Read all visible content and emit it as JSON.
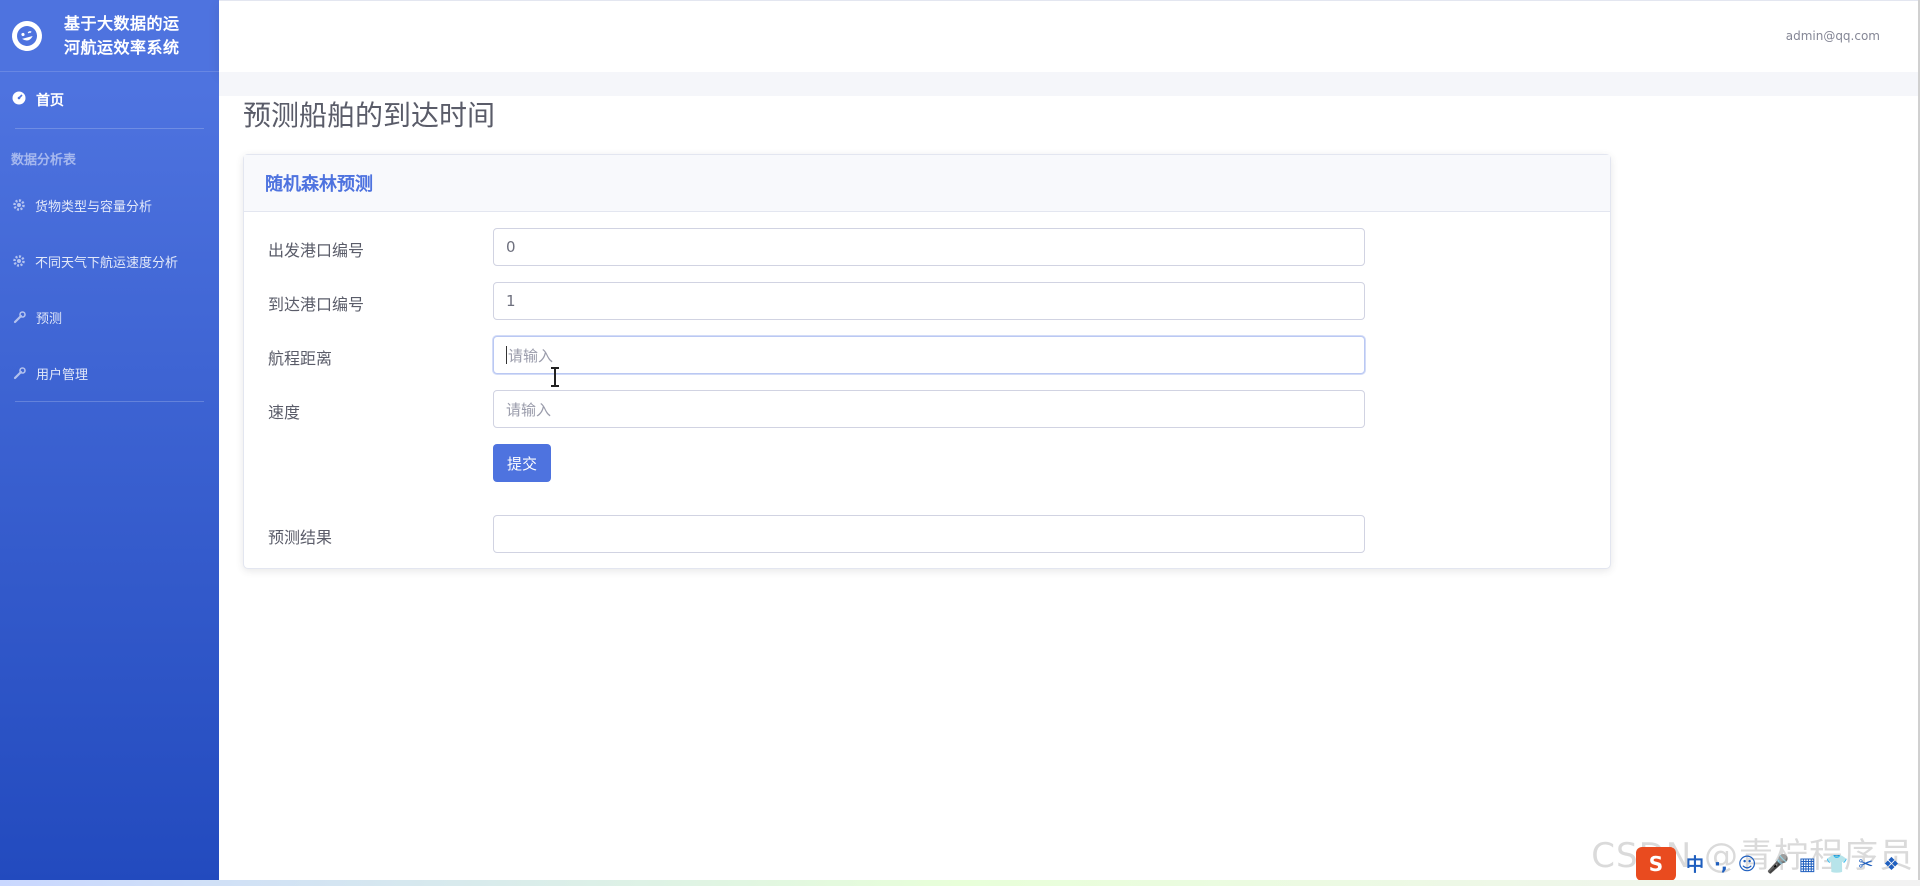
{
  "brand": {
    "title": "基于大数据的运河航运效率系统"
  },
  "sidebar": {
    "home_label": "首页",
    "section_heading": "数据分析表",
    "items": [
      {
        "label": "货物类型与容量分析",
        "icon": "gear-icon"
      },
      {
        "label": "不同天气下航运速度分析",
        "icon": "gear-icon"
      },
      {
        "label": "预测",
        "icon": "wrench-icon"
      },
      {
        "label": "用户管理",
        "icon": "wrench-icon"
      }
    ]
  },
  "topbar": {
    "user_email": "admin@qq.com"
  },
  "page": {
    "title": "预测船舶的到达时间"
  },
  "card": {
    "header": "随机森林预测",
    "fields": [
      {
        "label": "出发港口编号",
        "value": "0",
        "placeholder": ""
      },
      {
        "label": "到达港口编号",
        "value": "1",
        "placeholder": ""
      },
      {
        "label": "航程距离",
        "value": "",
        "placeholder": "请输入"
      },
      {
        "label": "速度",
        "value": "",
        "placeholder": "请输入"
      }
    ],
    "submit_label": "提交",
    "result": {
      "label": "预测结果",
      "value": ""
    }
  },
  "overlay": {
    "watermark": "CSDN @青柠程序员",
    "tray_logo": "S",
    "tray_items": [
      "中",
      "·,",
      "☺",
      "🎤",
      "▦",
      "👕",
      "✂",
      "❖"
    ]
  },
  "colors": {
    "primary": "#4e73df",
    "sidebar_gradient_end": "#224abe"
  }
}
